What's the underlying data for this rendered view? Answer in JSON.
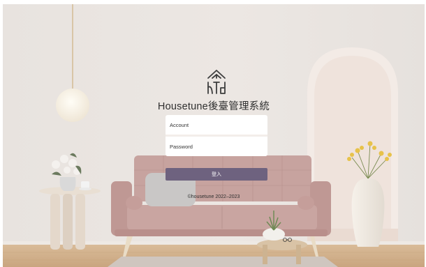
{
  "brand": {
    "logo_icon": "housetune-logo-icon",
    "title": "Housetune後臺管理系統"
  },
  "form": {
    "account_placeholder": "Account",
    "password_placeholder": "Password",
    "submit_label": "登入"
  },
  "footer": {
    "copyright": "©housetune 2022–2023"
  },
  "colors": {
    "button": "#6e627f",
    "wall": "#e9e4df",
    "sofa": "#c49f9b"
  }
}
